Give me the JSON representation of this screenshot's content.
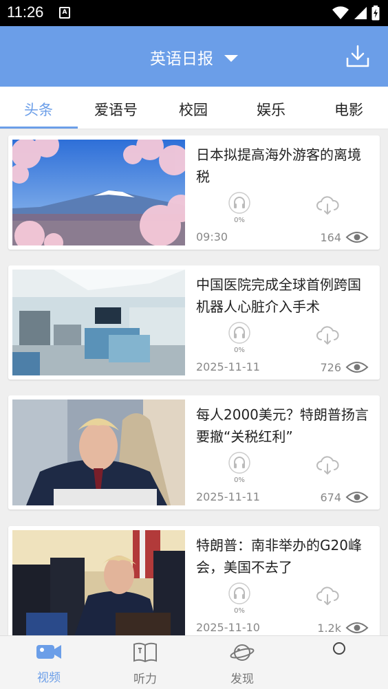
{
  "status_bar": {
    "time": "11:26",
    "app_icon_letter": "A"
  },
  "header": {
    "title": "英语日报",
    "download_icon": "download-tray-icon"
  },
  "tabs": [
    {
      "label": "头条",
      "active": true
    },
    {
      "label": "爱语号",
      "active": false
    },
    {
      "label": "校园",
      "active": false
    },
    {
      "label": "娱乐",
      "active": false
    },
    {
      "label": "电影",
      "active": false
    }
  ],
  "articles": [
    {
      "title": "日本拟提高海外游客的离境税",
      "progress": "0%",
      "date": "09:30",
      "views": "164"
    },
    {
      "title": "中国医院完成全球首例跨国机器人心脏介入手术",
      "progress": "0%",
      "date": "2025-11-11",
      "views": "726"
    },
    {
      "title": "每人2000美元？特朗普扬言要撤“关税红利”",
      "progress": "0%",
      "date": "2025-11-11",
      "views": "674"
    },
    {
      "title": "特朗普：南非举办的G20峰会，美国不去了",
      "progress": "0%",
      "date": "2025-11-10",
      "views": "1.2k"
    }
  ],
  "bottom_nav": [
    {
      "label": "视频",
      "icon": "video-camera-icon",
      "active": true
    },
    {
      "label": "听力",
      "icon": "book-icon",
      "active": false
    },
    {
      "label": "发现",
      "icon": "planet-icon",
      "active": false
    }
  ],
  "colors": {
    "accent": "#6b9ee8",
    "header_bg": "#6b9ee8",
    "text_gray": "#888888"
  }
}
